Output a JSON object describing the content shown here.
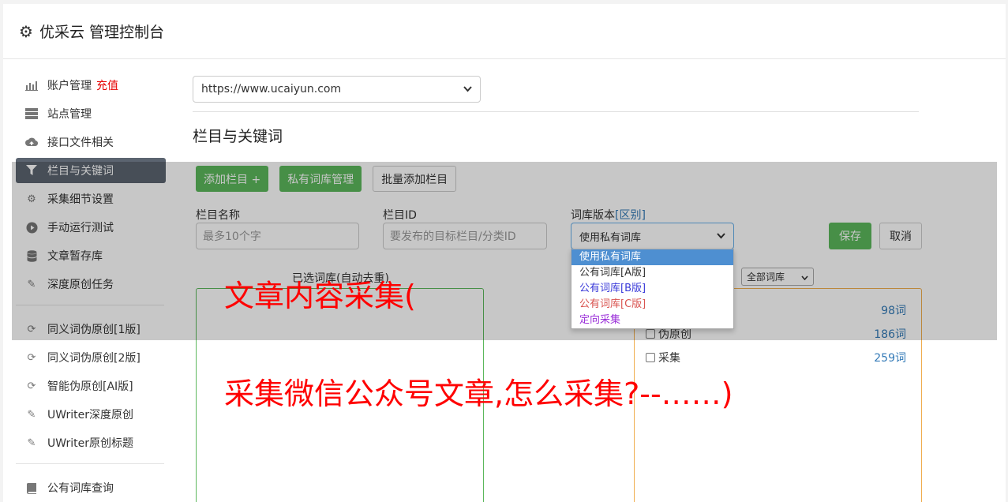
{
  "header": {
    "title": "优采云 管理控制台"
  },
  "sidebar": {
    "items": [
      {
        "label": "账户管理",
        "extra": "充值"
      },
      {
        "label": "站点管理"
      },
      {
        "label": "接口文件相关"
      },
      {
        "label": "栏目与关键词"
      },
      {
        "label": "采集细节设置"
      },
      {
        "label": "手动运行测试"
      },
      {
        "label": "文章暂存库"
      },
      {
        "label": "深度原创任务"
      },
      {
        "label": "同义词伪原创[1版]"
      },
      {
        "label": "同义词伪原创[2版]"
      },
      {
        "label": "智能伪原创[AI版]"
      },
      {
        "label": "UWriter深度原创"
      },
      {
        "label": "UWriter原创标题"
      },
      {
        "label": "公有词库查询"
      }
    ]
  },
  "main": {
    "site_select": "https://www.ucaiyun.com",
    "section_title": "栏目与关键词",
    "buttons": {
      "add_column": "添加栏目 +",
      "private_lib": "私有词库管理",
      "batch_add": "批量添加栏目"
    },
    "form": {
      "name_label": "栏目名称",
      "name_placeholder": "最多10个字",
      "id_label": "栏目ID",
      "id_placeholder": "要发布的目标栏目/分类ID",
      "version_label": "词库版本",
      "version_link": "[区别]",
      "version_value": "使用私有词库",
      "save": "保存",
      "cancel": "取消"
    },
    "dropdown_options": [
      "使用私有词库",
      "公有词库[A版]",
      "公有词库[B版]",
      "公有词库[C版]",
      "定向采集"
    ],
    "selected_label": "已选词库(自动去重)",
    "filter_value": "全部词库",
    "words": [
      {
        "label": "",
        "count": "98词"
      },
      {
        "label": "伪原创",
        "count": "186词"
      },
      {
        "label": "采集",
        "count": "259词"
      }
    ]
  },
  "overlay_text": {
    "line1": "文章内容采集(",
    "line2": "采集微信公众号文章,怎么采集?--……)"
  }
}
